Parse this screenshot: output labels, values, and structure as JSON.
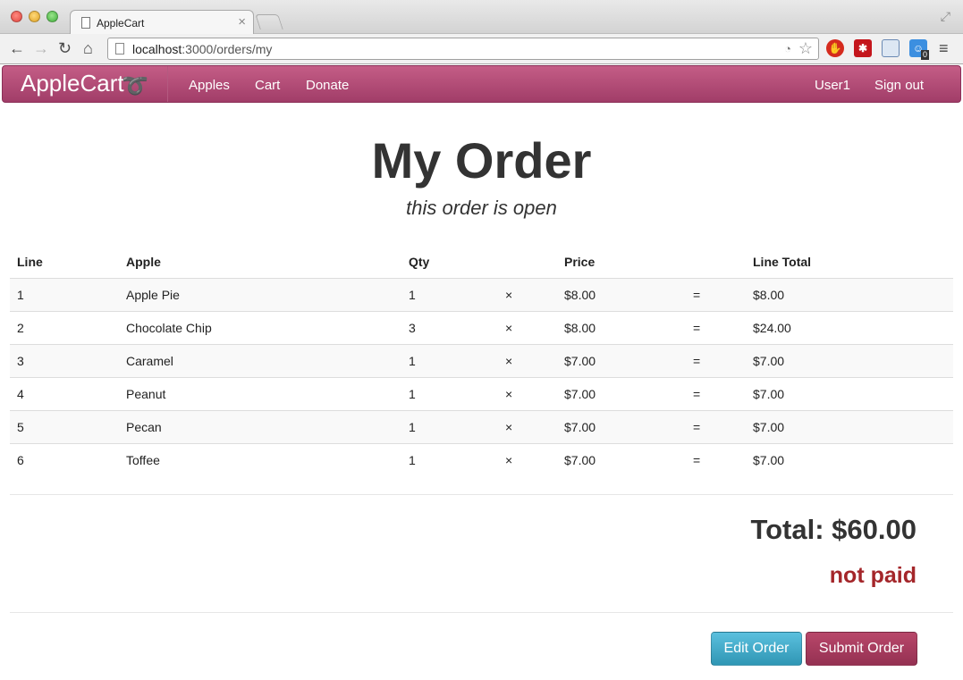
{
  "browser": {
    "tab_title": "AppleCart",
    "tab_close": "×",
    "url_host": "localhost",
    "url_path": ":3000/orders/my",
    "extension_badge": "0"
  },
  "navbar": {
    "brand": "AppleCart",
    "links": [
      "Apples",
      "Cart",
      "Donate"
    ],
    "user": "User1",
    "sign_out": "Sign out",
    "color": "#a13d68"
  },
  "order": {
    "title": "My Order",
    "subtitle": "this order is open",
    "columns": [
      "Line",
      "Apple",
      "Qty",
      "Price",
      "Line Total"
    ],
    "times_symbol": "×",
    "equals_symbol": "=",
    "rows": [
      {
        "line": "1",
        "apple": "Apple Pie",
        "qty": "1",
        "price": "$8.00",
        "line_total": "$8.00"
      },
      {
        "line": "2",
        "apple": "Chocolate Chip",
        "qty": "3",
        "price": "$8.00",
        "line_total": "$24.00"
      },
      {
        "line": "3",
        "apple": "Caramel",
        "qty": "1",
        "price": "$7.00",
        "line_total": "$7.00"
      },
      {
        "line": "4",
        "apple": "Peanut",
        "qty": "1",
        "price": "$7.00",
        "line_total": "$7.00"
      },
      {
        "line": "5",
        "apple": "Pecan",
        "qty": "1",
        "price": "$7.00",
        "line_total": "$7.00"
      },
      {
        "line": "6",
        "apple": "Toffee",
        "qty": "1",
        "price": "$7.00",
        "line_total": "$7.00"
      }
    ],
    "total": "Total: $60.00",
    "payment_status": "not paid",
    "payment_status_color": "#a4262a"
  },
  "actions": {
    "edit": "Edit Order",
    "submit": "Submit Order",
    "edit_color": "#2f96b4",
    "submit_color": "#953152"
  }
}
